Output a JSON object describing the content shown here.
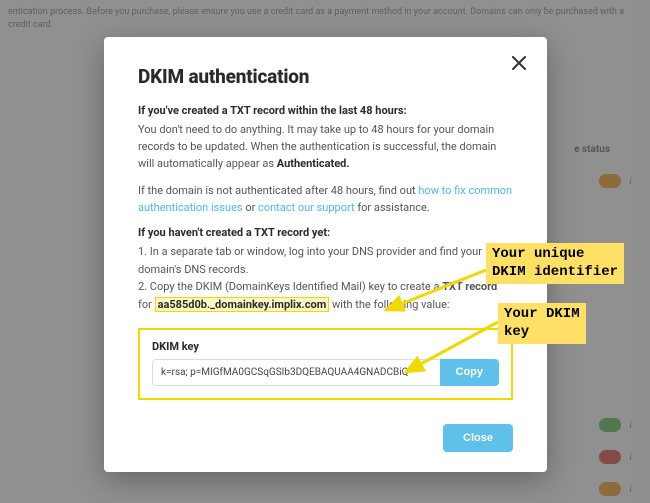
{
  "background": {
    "top_text": "entication process. Before you purchase, please ensure you use a credit card as a payment method in your account. Domains can only be purchased with a credit card.",
    "col_header": "e status"
  },
  "modal": {
    "title": "DKIM authentication",
    "para1_lead": "If you've created a TXT record within the last 48 hours:",
    "para1_body_a": "You don't need to do anything. It may take up to 48 hours for your domain records to be updated. When the authentication is successful, the domain will automatically appear as ",
    "para1_body_strong": "Authenticated.",
    "para2_a": "If the domain is not authenticated after 48 hours, find out ",
    "para2_link1": "how to fix common authentication issues",
    "para2_b": " or ",
    "para2_link2": "contact our support",
    "para2_c": " for assistance.",
    "para3_lead": "If you haven't created a TXT record yet:",
    "step1": "1. In a separate tab or window, log into your DNS provider and find your domain's DNS records.",
    "step2_a": "2. Copy the DKIM (DomainKeys Identified Mail) key to create a ",
    "step2_strong": "TXT record",
    "step2_b": " for ",
    "step2_domain": "aa585d0b._domainkey.implix.com",
    "step2_c": " with the following value:",
    "dkim_label": "DKIM key",
    "dkim_value": "k=rsa; p=MIGfMA0GCSqGSIb3DQEBAQUAA4GNADCBiQ",
    "copy": "Copy",
    "close": "Close"
  },
  "callouts": {
    "identifier": "Your unique\nDKIM identifier",
    "key": "Your DKIM\nkey"
  }
}
